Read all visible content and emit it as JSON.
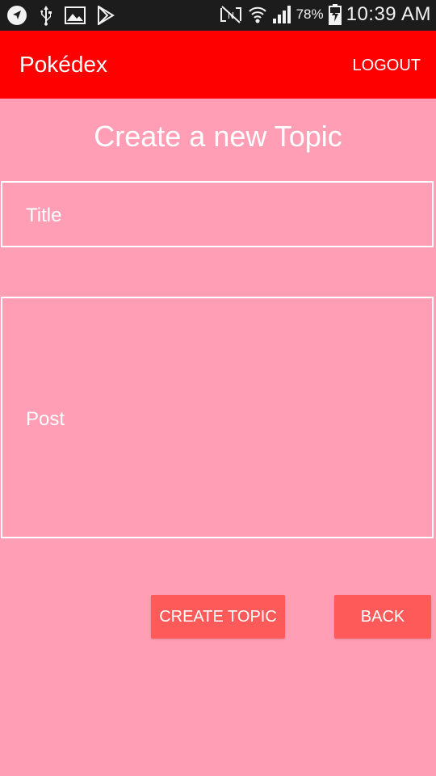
{
  "status_bar": {
    "battery_percent": "78%",
    "time": "10:39 AM",
    "icons": [
      "navigation-icon",
      "usb-icon",
      "image-icon",
      "play-store-icon",
      "nfc-icon",
      "wifi-icon",
      "signal-icon",
      "battery-charging-icon"
    ]
  },
  "app_bar": {
    "title": "Pokédex",
    "logout_label": "LOGOUT",
    "color": "#ff0000"
  },
  "page": {
    "heading": "Create a new Topic",
    "background_color": "#ff9eb5"
  },
  "form": {
    "title_placeholder": "Title",
    "post_placeholder": "Post"
  },
  "buttons": {
    "create_label": "CREATE TOPIC",
    "back_label": "BACK",
    "color": "#ff5a5a"
  }
}
